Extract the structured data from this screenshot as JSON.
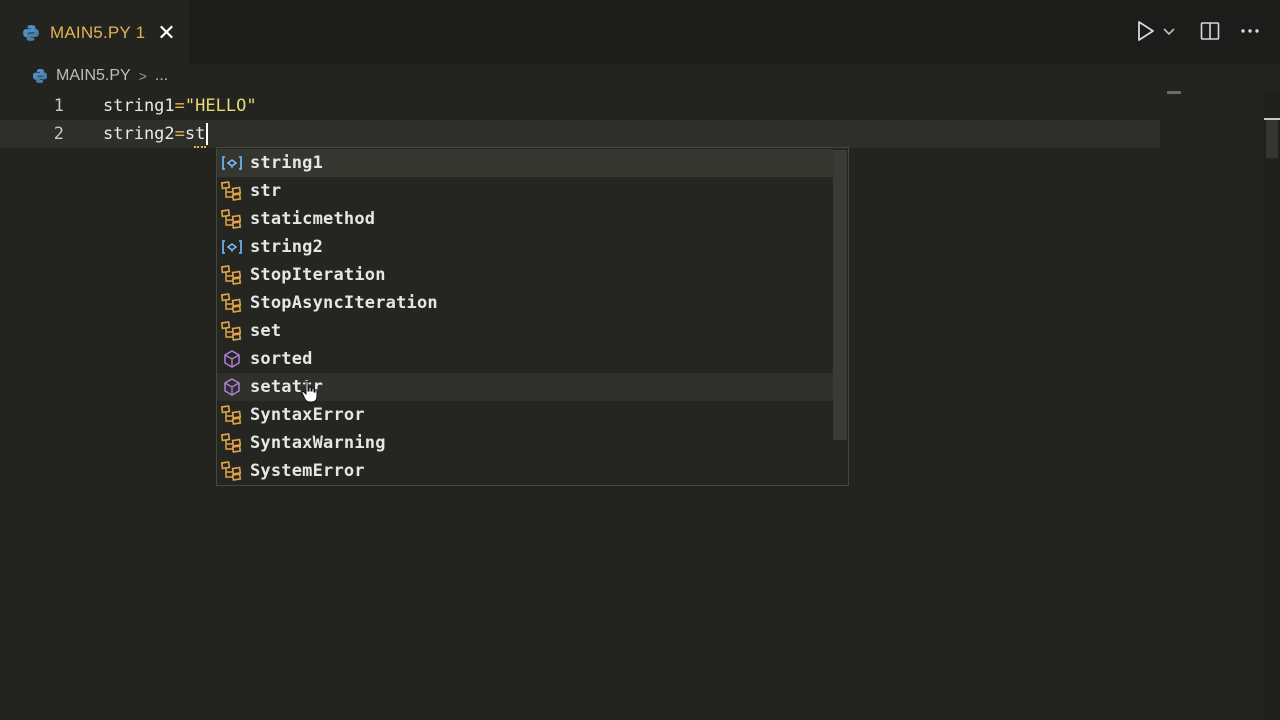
{
  "tab": {
    "title": "MAIN5.PY 1",
    "icon": "python-file-icon",
    "close_glyph": "✕"
  },
  "toolbar": {
    "run_icon": "play-icon",
    "run_menu_icon": "chevron-down-icon",
    "split_icon": "split-editor-icon",
    "more_icon": "more-actions-icon"
  },
  "breadcrumb": {
    "file": "MAIN5.PY",
    "separator": ">",
    "tail": "..."
  },
  "editor": {
    "lines": [
      {
        "number": "1",
        "tokens": [
          {
            "t": "string1",
            "c": "id"
          },
          {
            "t": "=",
            "c": "op"
          },
          {
            "t": "\"HELLO\"",
            "c": "str"
          }
        ]
      },
      {
        "number": "2",
        "tokens": [
          {
            "t": "string2",
            "c": "id"
          },
          {
            "t": "=",
            "c": "op"
          },
          {
            "t": "st",
            "c": "id"
          }
        ],
        "current": true
      }
    ]
  },
  "suggestions": {
    "items": [
      {
        "label": "string1",
        "kind": "variable",
        "icon": "variable-icon"
      },
      {
        "label": "str",
        "kind": "class",
        "icon": "class-icon"
      },
      {
        "label": "staticmethod",
        "kind": "class",
        "icon": "class-icon"
      },
      {
        "label": "string2",
        "kind": "variable",
        "icon": "variable-icon"
      },
      {
        "label": "StopIteration",
        "kind": "class",
        "icon": "class-icon"
      },
      {
        "label": "StopAsyncIteration",
        "kind": "class",
        "icon": "class-icon"
      },
      {
        "label": "set",
        "kind": "class",
        "icon": "class-icon"
      },
      {
        "label": "sorted",
        "kind": "function",
        "icon": "function-icon"
      },
      {
        "label": "setattr",
        "kind": "function",
        "icon": "function-icon"
      },
      {
        "label": "SyntaxError",
        "kind": "class",
        "icon": "class-icon"
      },
      {
        "label": "SyntaxWarning",
        "kind": "class",
        "icon": "class-icon"
      },
      {
        "label": "SystemError",
        "kind": "class",
        "icon": "class-icon"
      }
    ],
    "selected_index": 0,
    "hovered_index": 8
  },
  "colors": {
    "class_icon": "#e0a44a",
    "variable_icon": "#75beff",
    "function_icon": "#b180d7",
    "accent": "#e0b455"
  }
}
